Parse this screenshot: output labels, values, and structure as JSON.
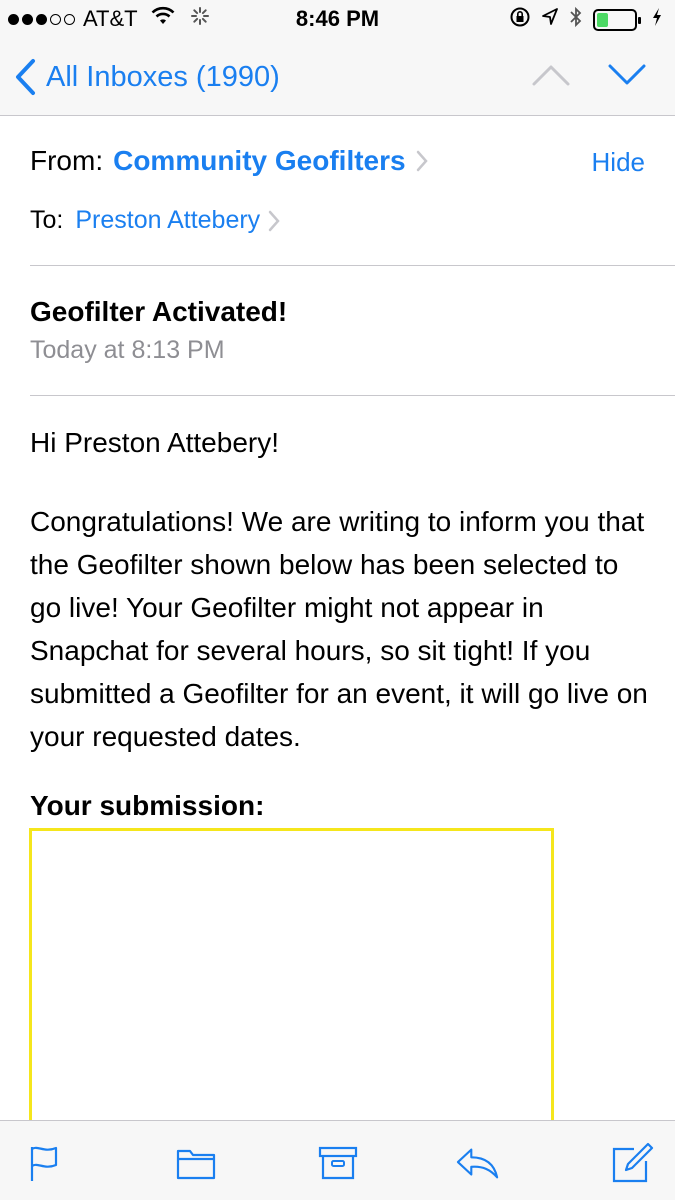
{
  "status_bar": {
    "carrier": "AT&T",
    "time": "8:46 PM",
    "battery_level": 0.3
  },
  "nav": {
    "back_label": "All Inboxes (1990)"
  },
  "email": {
    "from_label": "From:",
    "from_name": "Community Geofilters",
    "hide_label": "Hide",
    "to_label": "To:",
    "to_name": "Preston Attebery",
    "subject": "Geofilter Activated!",
    "date": "Today at 8:13 PM",
    "greeting": "Hi Preston Attebery!",
    "body": "Congratulations! We are writing to inform you that the Geofilter shown below has been selected to go live! Your Geofilter might not appear in Snapchat for several hours, so sit tight! If you submitted a Geofilter for an event, it will go live on your requested dates.",
    "submission_label": "Your submission:"
  },
  "toolbar": {
    "icons": [
      "flag-icon",
      "folder-icon",
      "archive-icon",
      "reply-icon",
      "compose-icon"
    ]
  },
  "colors": {
    "accent": "#1a7ff0",
    "submission_border": "#f5e61c",
    "battery": "#4cd964"
  }
}
